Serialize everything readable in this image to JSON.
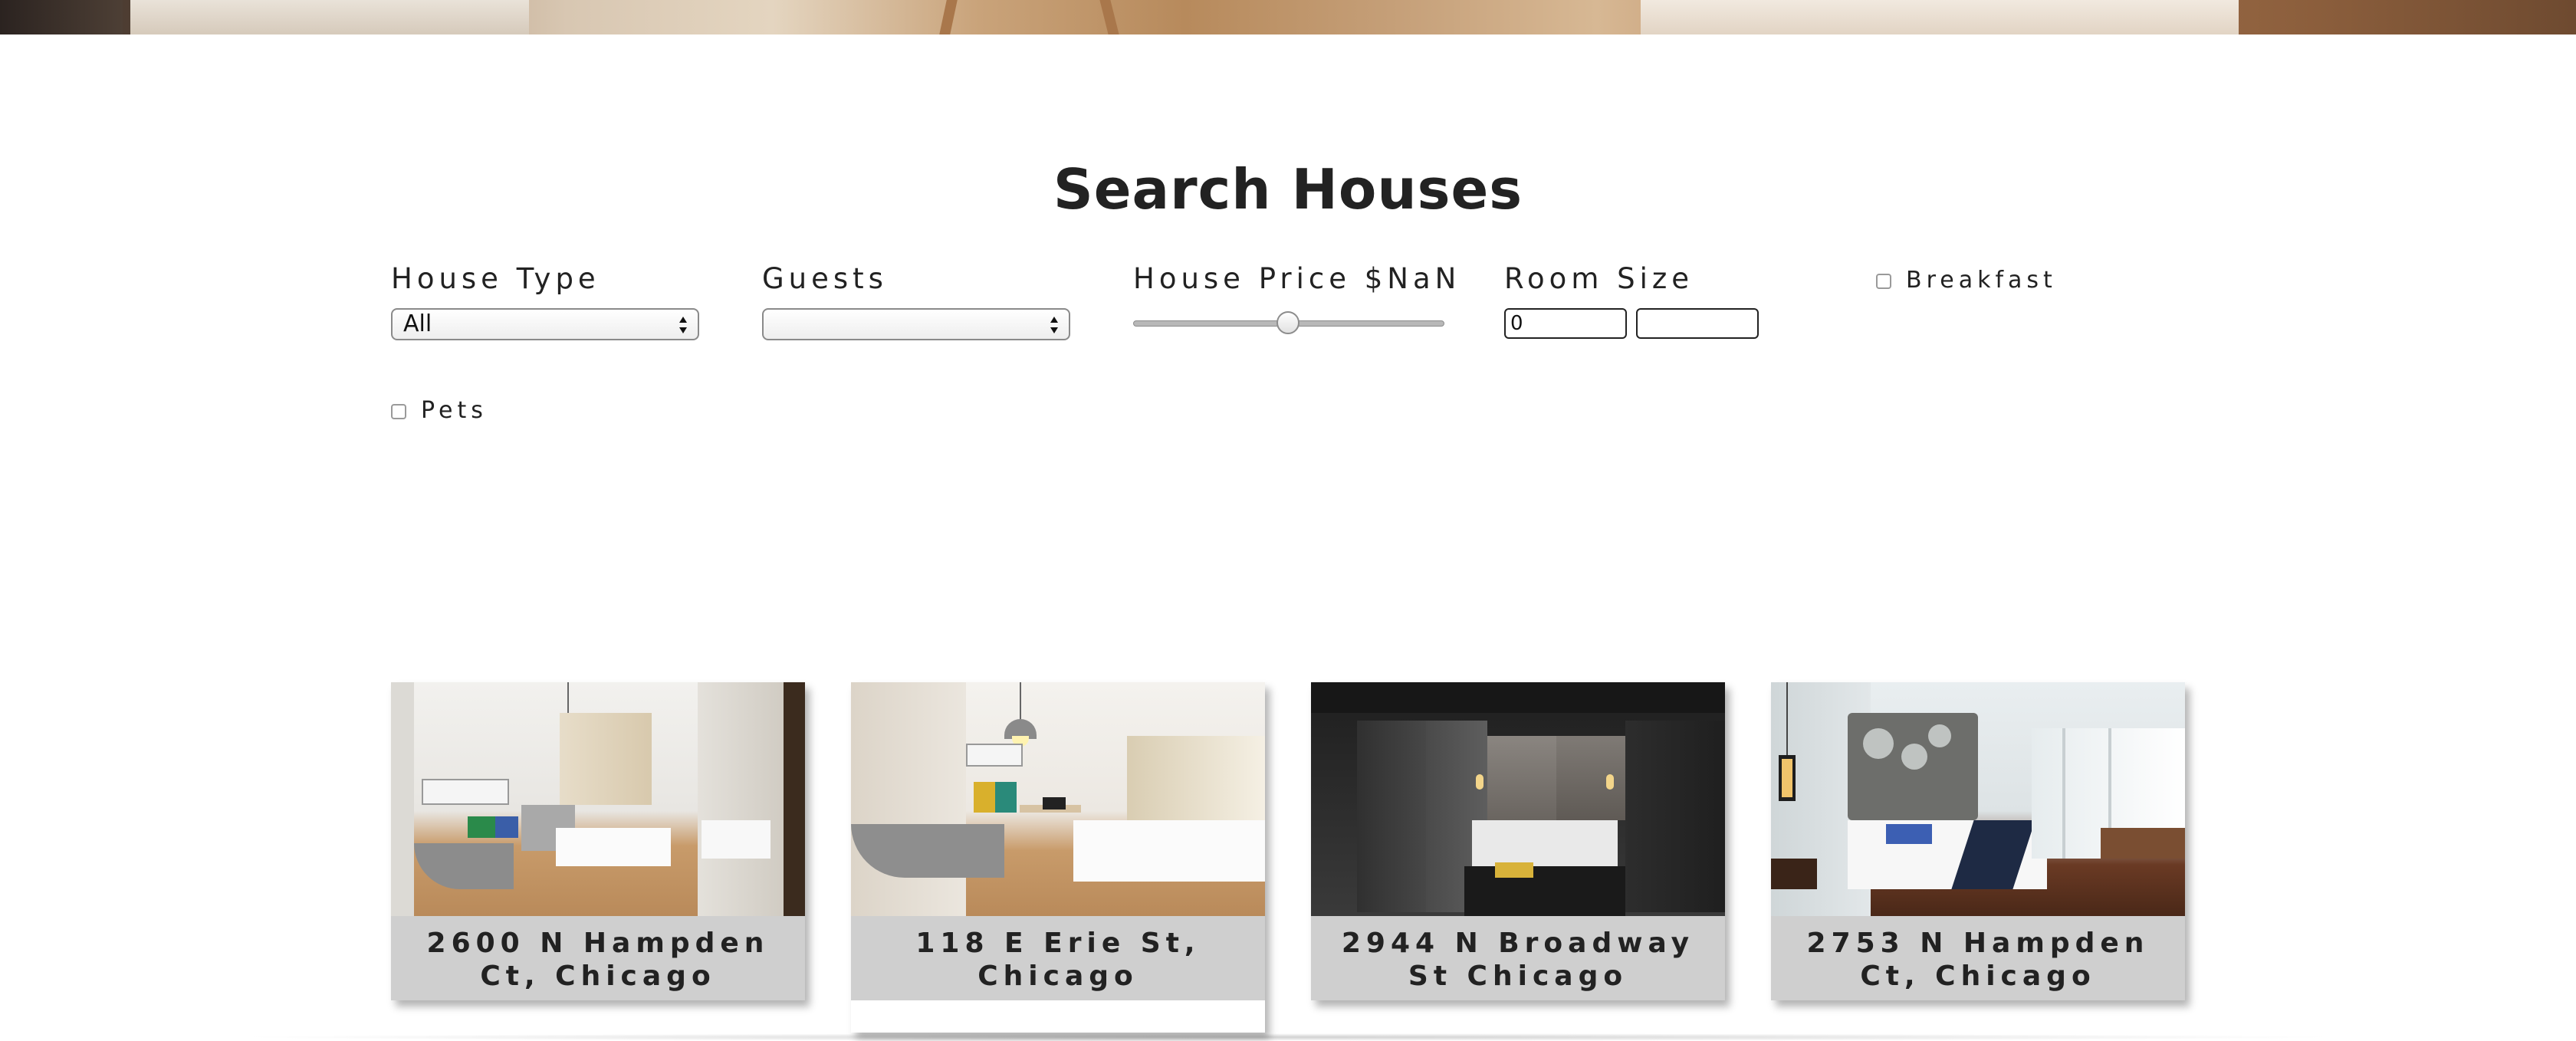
{
  "header": {
    "title": "Search Houses"
  },
  "filters": {
    "house_type": {
      "label": "House Type",
      "selected": "All"
    },
    "guests": {
      "label": "Guests",
      "selected": ""
    },
    "price": {
      "label": "House Price $NaN",
      "slider_fraction": 0.5
    },
    "room_size": {
      "label": "Room Size",
      "min_value": "0",
      "max_value": ""
    },
    "breakfast": {
      "label": "Breakfast",
      "checked": false
    },
    "pets": {
      "label": "Pets",
      "checked": false
    }
  },
  "rooms": [
    {
      "address": "2600 N Hampden Ct, Chicago"
    },
    {
      "address": "118 E Erie St, Chicago"
    },
    {
      "address": "2944 N Broadway St Chicago"
    },
    {
      "address": "2753 N Hampden Ct, Chicago"
    }
  ]
}
